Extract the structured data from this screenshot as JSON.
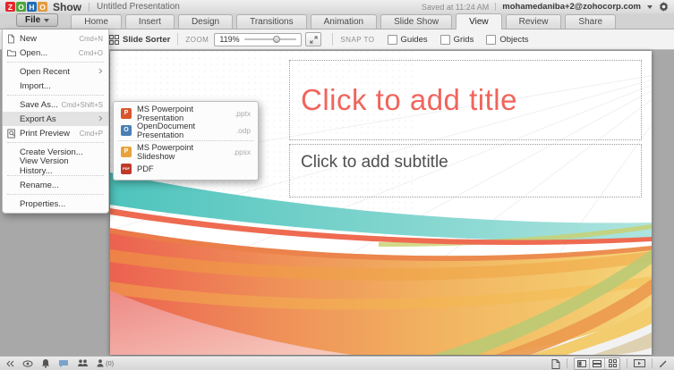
{
  "app": {
    "logo": {
      "letters": [
        "Z",
        "O",
        "H",
        "O"
      ],
      "colors": [
        "#e4272c",
        "#4da53c",
        "#226db4",
        "#e79a3c"
      ]
    },
    "product_name": "Show",
    "document_title": "Untitled Presentation",
    "saved_status": "Saved at 11:24 AM",
    "user_email": "mohamedaniba+2@zohocorp.com"
  },
  "tabs": {
    "file_label": "File",
    "items": [
      "Home",
      "Insert",
      "Design",
      "Transitions",
      "Animation",
      "Slide Show",
      "View",
      "Review",
      "Share"
    ],
    "active": "View"
  },
  "toolbar": {
    "slide_sorter_label": "Slide Sorter",
    "zoom_label": "ZOOM",
    "zoom_value": "119%",
    "snap_to_label": "SNAP TO",
    "checkboxes": [
      "Guides",
      "Grids",
      "Objects"
    ]
  },
  "file_menu": {
    "items": [
      {
        "label": "New",
        "shortcut": "Cmd+N"
      },
      {
        "label": "Open...",
        "shortcut": "Cmd+O"
      },
      {
        "label": "Open Recent",
        "shortcut": ""
      },
      {
        "label": "Import...",
        "shortcut": ""
      },
      {
        "label": "Save As...",
        "shortcut": "Cmd+Shift+S"
      },
      {
        "label": "Export As",
        "shortcut": ""
      },
      {
        "label": "Print Preview",
        "shortcut": "Cmd+P"
      },
      {
        "label": "Create Version...",
        "shortcut": ""
      },
      {
        "label": "View Version History...",
        "shortcut": ""
      },
      {
        "label": "Rename...",
        "shortcut": ""
      },
      {
        "label": "Properties...",
        "shortcut": ""
      }
    ]
  },
  "export_submenu": {
    "items": [
      {
        "label": "MS Powerpoint Presentation",
        "ext": ".pptx",
        "icon_letter": "P",
        "icon_color": "#d9552e"
      },
      {
        "label": "OpenDocument Presentation",
        "ext": ".odp",
        "icon_letter": "O",
        "icon_color": "#4a7fb5"
      },
      {
        "label": "MS Powerpoint Slideshow",
        "ext": ".ppsx",
        "icon_letter": "P",
        "icon_color": "#e8a33d"
      },
      {
        "label": "PDF",
        "ext": "",
        "icon_letter": "PDF",
        "icon_color": "#c03a2b"
      }
    ]
  },
  "slide": {
    "title_placeholder": "Click to add title",
    "subtitle_placeholder": "Click to add subtitle",
    "title_color": "#f0655c",
    "theme_colors": {
      "teal": "#5bc8c0",
      "salmon": "#ed6a5a",
      "orange": "#f0945c",
      "yellow": "#f2c96c",
      "pink": "#f2a39e",
      "olive": "#b9ca74"
    }
  },
  "status_bar": {
    "left_icons": [
      "collapse-panel",
      "eye",
      "bell",
      "comment",
      "people",
      "person"
    ],
    "collaborator_count": "(0)",
    "right_icons": [
      "new-slide",
      "normal-view",
      "slide-sorter-view",
      "grid-view",
      "present",
      "draw"
    ]
  }
}
